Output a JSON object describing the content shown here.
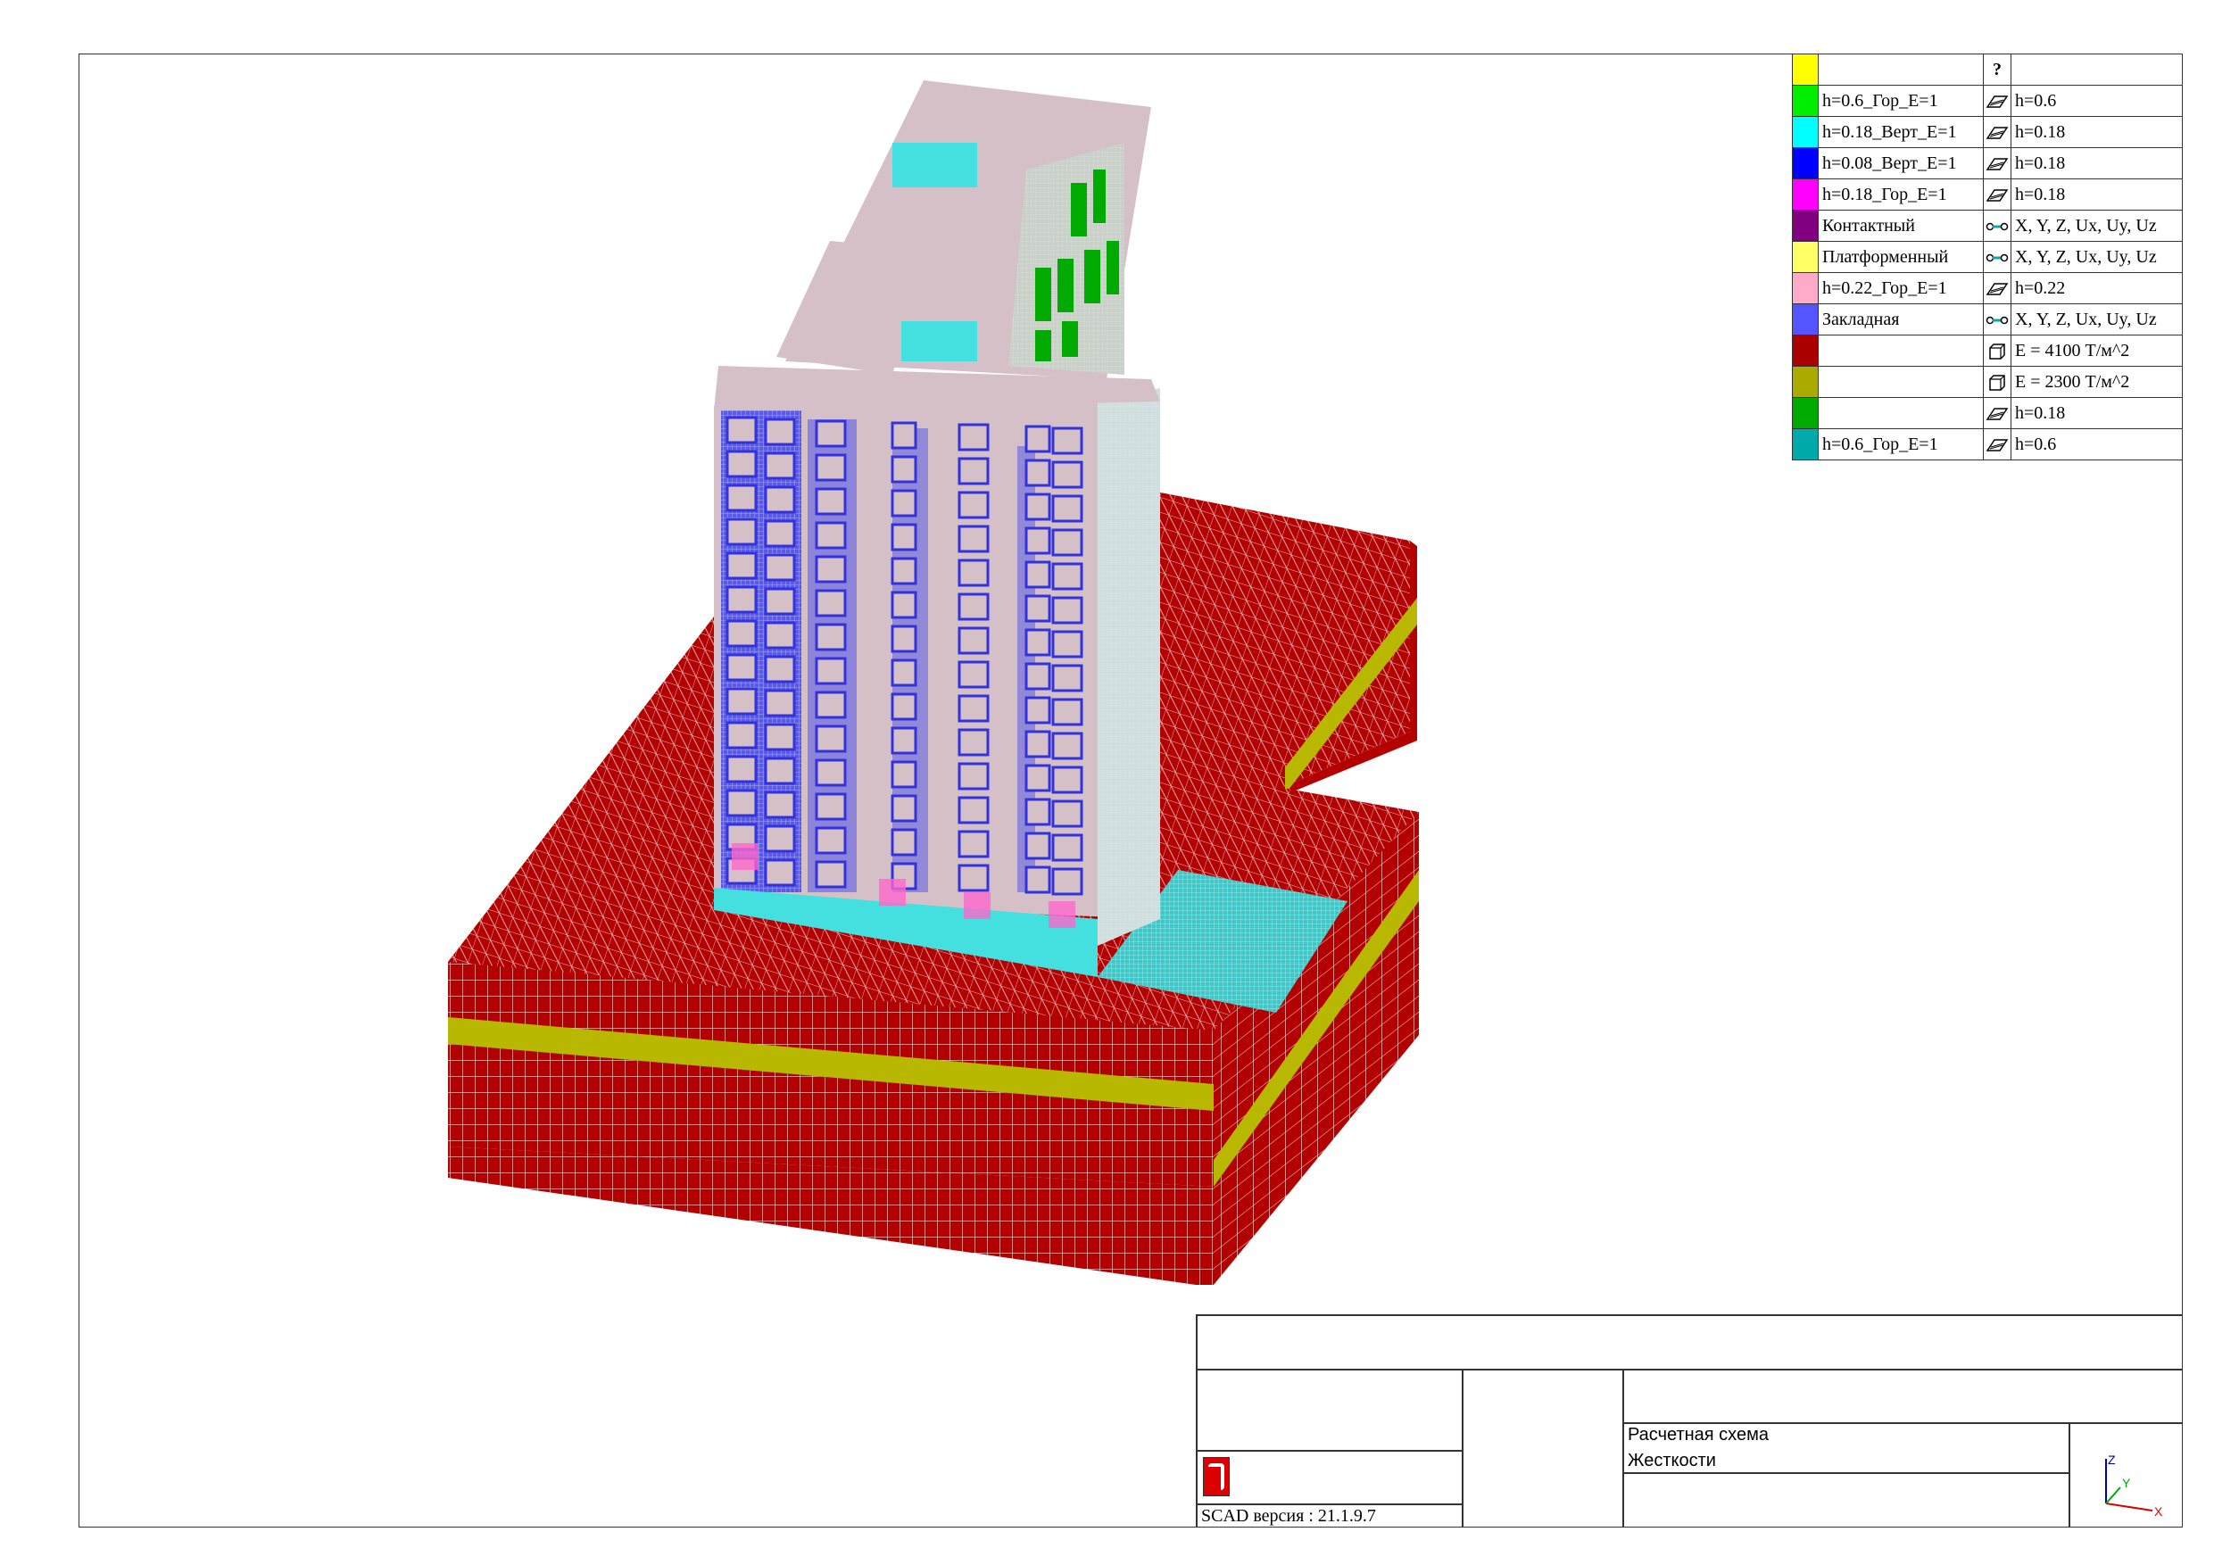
{
  "legend": {
    "header_mark": "?",
    "rows": [
      {
        "color": "#00ee00",
        "name": "h=0.6_Гор_Е=1",
        "icon": "plate-icon",
        "value": "h=0.6"
      },
      {
        "color": "#00ffff",
        "name": "h=0.18_Верт_Е=1",
        "icon": "plate-icon",
        "value": "h=0.18"
      },
      {
        "color": "#0000ff",
        "name": "h=0.08_Верт_Е=1",
        "icon": "plate-icon",
        "value": "h=0.18"
      },
      {
        "color": "#ff00ff",
        "name": "h=0.18_Гор_Е=1",
        "icon": "plate-icon",
        "value": "h=0.18"
      },
      {
        "color": "#800080",
        "name": "Контактный",
        "icon": "link-icon",
        "value": "X, Y, Z, Ux, Uy, Uz"
      },
      {
        "color": "#ffff66",
        "name": "Платформенный",
        "icon": "link-icon",
        "value": "X, Y, Z, Ux, Uy, Uz"
      },
      {
        "color": "#ffaac8",
        "name": "h=0.22_Гор_Е=1",
        "icon": "plate-icon",
        "value": "h=0.22"
      },
      {
        "color": "#5555ff",
        "name": "Закладная",
        "icon": "link-icon",
        "value": "X, Y, Z, Ux, Uy, Uz"
      },
      {
        "color": "#aa0000",
        "name": "",
        "icon": "solid-icon",
        "value": "E = 4100 Т/м^2"
      },
      {
        "color": "#aaaa00",
        "name": "",
        "icon": "solid-icon",
        "value": "E = 2300 Т/м^2"
      },
      {
        "color": "#00aa00",
        "name": "",
        "icon": "plate-icon",
        "value": "h=0.18"
      },
      {
        "color": "#00aaaa",
        "name": "h=0.6_Гор_Е=1",
        "icon": "plate-icon",
        "value": "h=0.6"
      }
    ],
    "header_color": "#ffff00"
  },
  "title_block": {
    "program": "SCAD версия : 21.1.9.7",
    "scheme_label": "Расчетная схема",
    "mode_label": "Жесткости",
    "logo_color": "#dd0000"
  },
  "axes": {
    "x": "X",
    "y": "Y",
    "z": "Z"
  },
  "colors": {
    "soil_main": "#b30000",
    "soil_layer": "#b8b800",
    "slab": "#d6c0c8",
    "window": "#3333dd",
    "cyan": "#44e0e0",
    "green": "#00aa00",
    "pink": "#ff66cc"
  }
}
